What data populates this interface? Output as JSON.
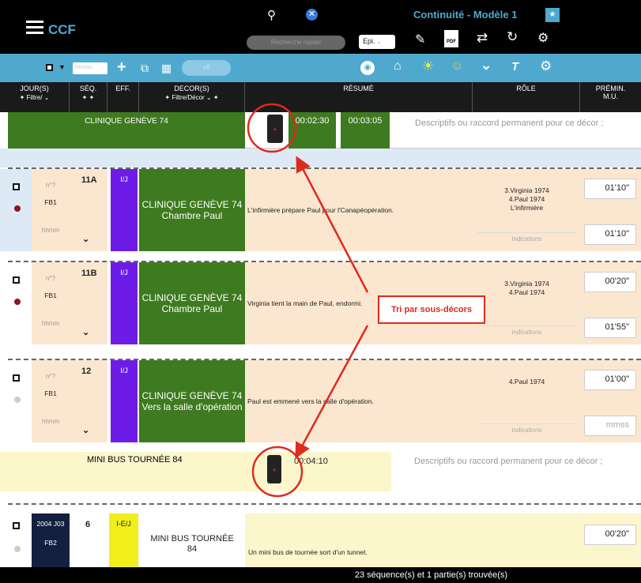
{
  "app": {
    "title": "CCF",
    "model_title": "Continuité - Modèle 1",
    "search_placeholder": "Recherche rapide",
    "epi_label": "Epi.",
    "toggle_label": "off"
  },
  "toolbar": {
    "filter_label": "Niveau"
  },
  "columns": {
    "jours": "JOUR(S)",
    "jours_filter": "Filtre/",
    "seq": "SÉQ.",
    "eff": "EFF.",
    "decor": "DECOR(S)",
    "decor_filter": "Filtre/Décor",
    "resume": "RÉSUMÉ",
    "role": "RÔLE",
    "premin": "PRÉMIN.",
    "premin_unit": "M.U."
  },
  "group1": {
    "title": "CLINIQUE GENÈVE 74",
    "time1": "00:02:30",
    "time2": "00:03:05",
    "desc": "Descriptifs ou raccord permanent pour ce décor ;"
  },
  "rows": [
    {
      "num": "n°?",
      "fb": "FB1",
      "hhmm": "hhmm",
      "seq": "11A",
      "eff": "I/J",
      "decor1": "CLINIQUE GENÈVE 74",
      "decor2": "Chambre Paul",
      "resume": "L'infirmière prépare Paul pour l'Canapéopération.",
      "roles": [
        "3.Virginia 1974",
        "4.Paul 1974",
        "L'infirmière"
      ],
      "ind": "indications",
      "v1": "01'10\"",
      "v2": "01'10\""
    },
    {
      "num": "n°?",
      "fb": "FB1",
      "hhmm": "hhmm",
      "seq": "11B",
      "eff": "I/J",
      "decor1": "CLINIQUE GENÈVE 74",
      "decor2": "Chambre Paul",
      "resume": "Virginia tient la main de Paul, endormi.",
      "roles": [
        "3.Virginia 1974",
        "4.Paul 1974"
      ],
      "ind": "indications",
      "v1": "00'20\"",
      "v2": "01'55\""
    },
    {
      "num": "n°?",
      "fb": "FB1",
      "hhmm": "hhmm",
      "seq": "12",
      "eff": "I/J",
      "decor1": "CLINIQUE GENÈVE 74",
      "decor2": "Vers la salle d'opération",
      "resume": "Paul est emmené vers la salle d'opération.",
      "roles": [
        "4.Paul 1974"
      ],
      "ind": "indications",
      "v1": "01'00\"",
      "v2": "mmss"
    }
  ],
  "group2": {
    "title": "MINI BUS TOURNÉE 84",
    "time1": "00:04:10",
    "desc": "Descriptifs ou raccord permanent pour ce décor ;"
  },
  "row4": {
    "num": "2004 J03",
    "fb": "FB2",
    "seq": "6",
    "eff": "I-E/J",
    "decor1": "MINI BUS TOURNÉE",
    "decor2": "84",
    "resume": "Un mini bus de tournée sort d'un tunnel.",
    "v1": "00'20\""
  },
  "annotation": "Tri par sous-décors",
  "footer": "23 séquence(s) et 1 partie(s) trouvée(s)",
  "colors": {
    "accent": "#4fa9cf",
    "green": "#3e7a1f",
    "purple": "#6d1ce8",
    "annotation": "#e02a1c"
  }
}
